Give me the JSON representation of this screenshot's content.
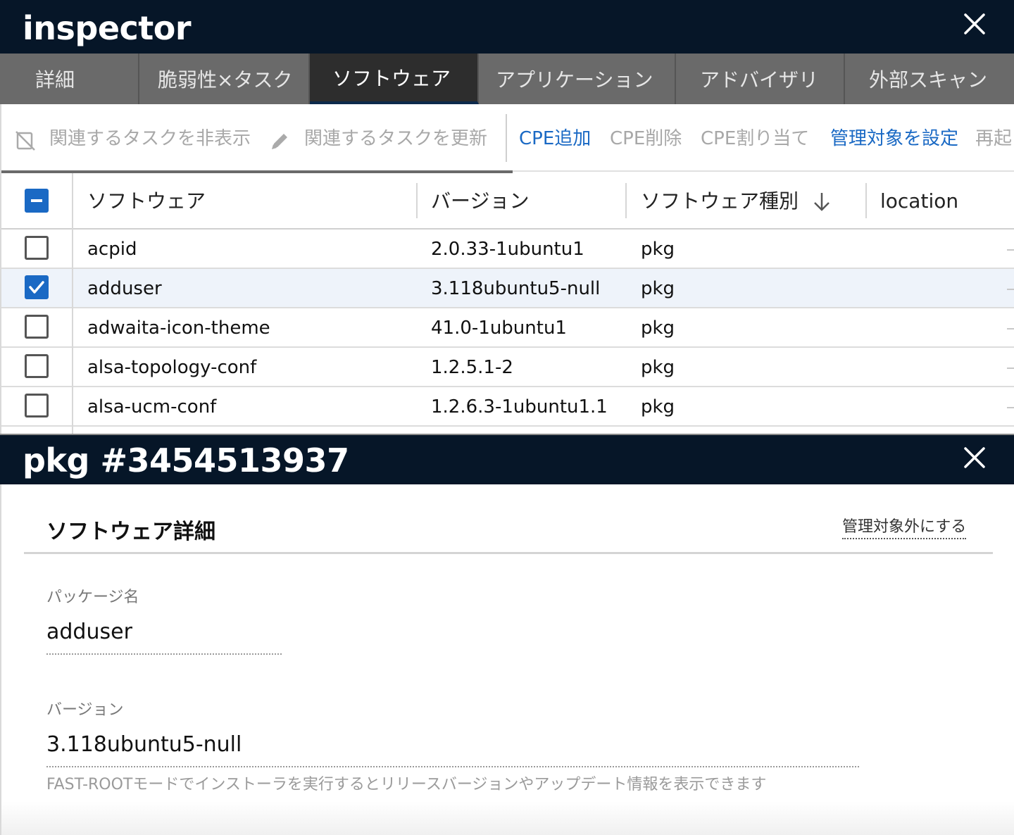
{
  "inspector": {
    "title": "inspector",
    "close_icon": "close-icon"
  },
  "tabs": [
    {
      "label": "詳細"
    },
    {
      "label": "脆弱性×タスク"
    },
    {
      "label": "ソフトウェア",
      "active": true
    },
    {
      "label": "アプリケーション"
    },
    {
      "label": "アドバイザリ"
    },
    {
      "label": "外部スキャン"
    }
  ],
  "toolbar": {
    "hide_related": "関連するタスクを非表示",
    "update_related": "関連するタスクを更新",
    "cpe_add": "CPE追加",
    "cpe_delete": "CPE削除",
    "cpe_assign": "CPE割り当て",
    "set_managed": "管理対象を設定",
    "restart": "再起"
  },
  "table": {
    "columns": {
      "software": "ソフトウェア",
      "version": "バージョン",
      "type": "ソフトウェア種別",
      "location": "location"
    },
    "sort_icon": "arrow-down-icon",
    "rows": [
      {
        "checked": false,
        "name": "acpid",
        "version": "2.0.33-1ubuntu1",
        "type": "pkg"
      },
      {
        "checked": true,
        "name": "adduser",
        "version": "3.118ubuntu5-null",
        "type": "pkg"
      },
      {
        "checked": false,
        "name": "adwaita-icon-theme",
        "version": "41.0-1ubuntu1",
        "type": "pkg"
      },
      {
        "checked": false,
        "name": "alsa-topology-conf",
        "version": "1.2.5.1-2",
        "type": "pkg"
      },
      {
        "checked": false,
        "name": "alsa-ucm-conf",
        "version": "1.2.6.3-1ubuntu1.1",
        "type": "pkg"
      }
    ]
  },
  "detail": {
    "title": "pkg #3454513937",
    "section_title": "ソフトウェア詳細",
    "unmanage_link": "管理対象外にする",
    "package_label": "パッケージ名",
    "package_value": "adduser",
    "version_label": "バージョン",
    "version_value": "3.118ubuntu5-null",
    "version_hint": "FAST-ROOTモードでインストーラを実行するとリリースバージョンやアップデート情報を表示できます"
  },
  "colors": {
    "header_bg": "#061628",
    "tab_bg": "#6a6a6a",
    "tab_active_bg": "#2d2d2d",
    "link_blue": "#1a69c4",
    "checkbox_blue": "#1a69c4",
    "selected_row_bg": "#eef3fa"
  }
}
